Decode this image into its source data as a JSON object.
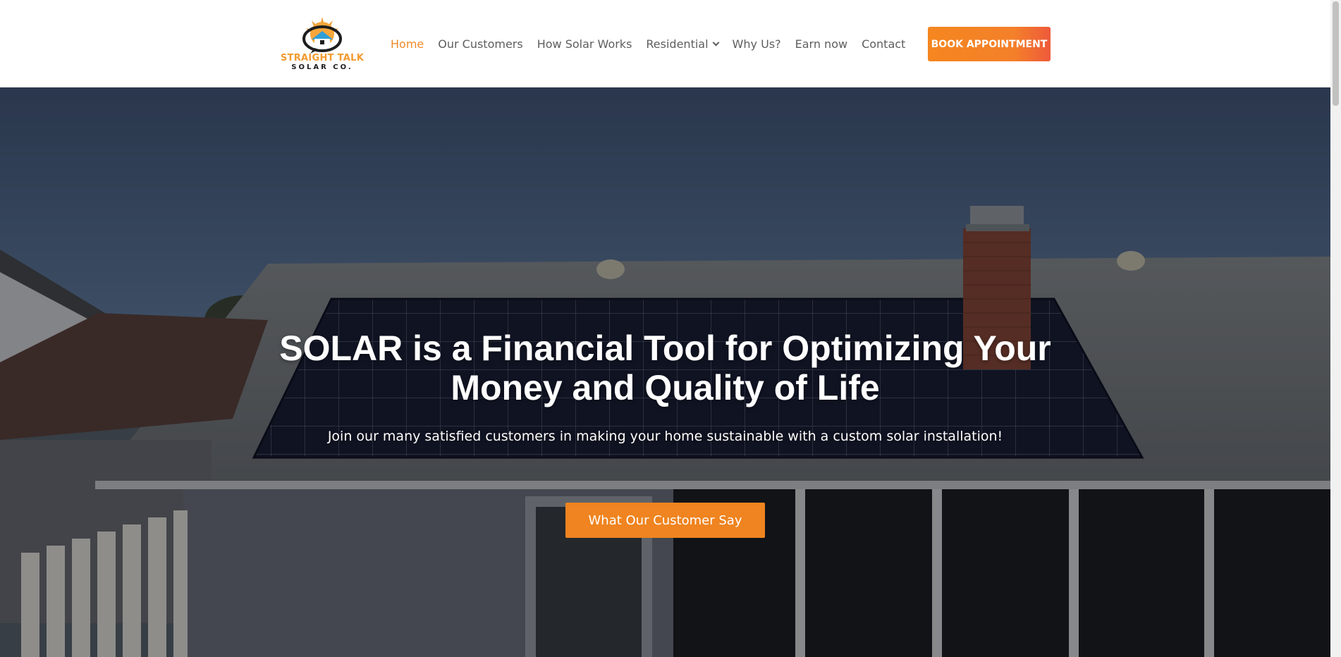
{
  "logo": {
    "line1": "STRAIGHT TALK",
    "line2": "SOLAR CO."
  },
  "nav": {
    "items": [
      {
        "label": "Home",
        "active": true
      },
      {
        "label": "Our Customers"
      },
      {
        "label": "How Solar Works"
      },
      {
        "label": "Residential",
        "has_dropdown": true
      },
      {
        "label": "Why Us?"
      },
      {
        "label": "Earn now"
      },
      {
        "label": "Contact"
      }
    ],
    "book_label": "BOOK APPOINTMENT"
  },
  "hero": {
    "title_line1": "SOLAR is a Financial Tool for Optimizing Your",
    "title_line2": "Money and Quality of Life",
    "subtitle": "Join our many satisfied customers in making your home sustainable with a custom solar installation!",
    "cta_label": "What Our Customer Say"
  },
  "colors": {
    "accent": "#ef8a2a",
    "nav_text": "#5e5e5e",
    "cta": "#ef8420"
  }
}
